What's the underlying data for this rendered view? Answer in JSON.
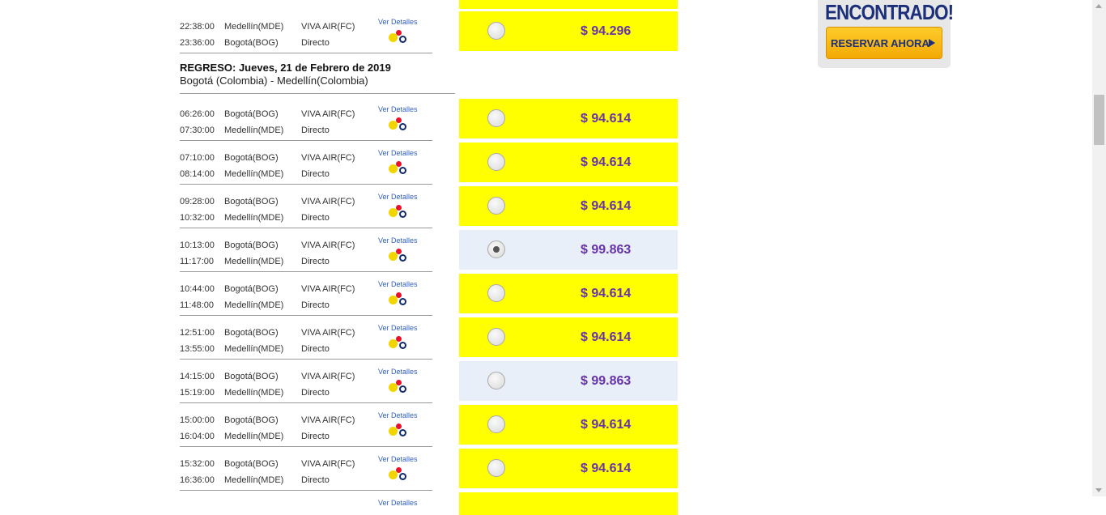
{
  "colors": {
    "price_bg": "#ffff00",
    "selected_bg": "#e9eff8",
    "price_text": "#6633aa",
    "link": "#3060c0"
  },
  "outbound": {
    "flights": [
      {
        "dep_time": "22:38:00",
        "dep_city": "Medellín(MDE)",
        "arr_time": "23:36:00",
        "arr_city": "Bogotá(BOG)",
        "airline": "VIVA AIR(FC)",
        "stops": "Directo",
        "details": "Ver Detalles",
        "price": "$ 94.296",
        "selected": false
      }
    ]
  },
  "return_section": {
    "title": "REGRESO: Jueves, 21 de Febrero de 2019",
    "route": "Bogotá (Colombia) - Medellín(Colombia)",
    "flights": [
      {
        "dep_time": "06:26:00",
        "dep_city": "Bogotá(BOG)",
        "arr_time": "07:30:00",
        "arr_city": "Medellín(MDE)",
        "airline": "VIVA AIR(FC)",
        "stops": "Directo",
        "details": "Ver Detalles",
        "price": "$ 94.614",
        "selected": false
      },
      {
        "dep_time": "07:10:00",
        "dep_city": "Bogotá(BOG)",
        "arr_time": "08:14:00",
        "arr_city": "Medellín(MDE)",
        "airline": "VIVA AIR(FC)",
        "stops": "Directo",
        "details": "Ver Detalles",
        "price": "$ 94.614",
        "selected": false
      },
      {
        "dep_time": "09:28:00",
        "dep_city": "Bogotá(BOG)",
        "arr_time": "10:32:00",
        "arr_city": "Medellín(MDE)",
        "airline": "VIVA AIR(FC)",
        "stops": "Directo",
        "details": "Ver Detalles",
        "price": "$ 94.614",
        "selected": false
      },
      {
        "dep_time": "10:13:00",
        "dep_city": "Bogotá(BOG)",
        "arr_time": "11:17:00",
        "arr_city": "Medellín(MDE)",
        "airline": "VIVA AIR(FC)",
        "stops": "Directo",
        "details": "Ver Detalles",
        "price": "$ 99.863",
        "selected": true,
        "highlight": "plain"
      },
      {
        "dep_time": "10:44:00",
        "dep_city": "Bogotá(BOG)",
        "arr_time": "11:48:00",
        "arr_city": "Medellín(MDE)",
        "airline": "VIVA AIR(FC)",
        "stops": "Directo",
        "details": "Ver Detalles",
        "price": "$ 94.614",
        "selected": false
      },
      {
        "dep_time": "12:51:00",
        "dep_city": "Bogotá(BOG)",
        "arr_time": "13:55:00",
        "arr_city": "Medellín(MDE)",
        "airline": "VIVA AIR(FC)",
        "stops": "Directo",
        "details": "Ver Detalles",
        "price": "$ 94.614",
        "selected": false
      },
      {
        "dep_time": "14:15:00",
        "dep_city": "Bogotá(BOG)",
        "arr_time": "15:19:00",
        "arr_city": "Medellín(MDE)",
        "airline": "VIVA AIR(FC)",
        "stops": "Directo",
        "details": "Ver Detalles",
        "price": "$ 99.863",
        "selected": false,
        "highlight": "plain"
      },
      {
        "dep_time": "15:00:00",
        "dep_city": "Bogotá(BOG)",
        "arr_time": "16:04:00",
        "arr_city": "Medellín(MDE)",
        "airline": "VIVA AIR(FC)",
        "stops": "Directo",
        "details": "Ver Detalles",
        "price": "$ 94.614",
        "selected": false
      },
      {
        "dep_time": "15:32:00",
        "dep_city": "Bogotá(BOG)",
        "arr_time": "16:36:00",
        "arr_city": "Medellín(MDE)",
        "airline": "VIVA AIR(FC)",
        "stops": "Directo",
        "details": "Ver Detalles",
        "price": "$ 94.614",
        "selected": false
      },
      {
        "dep_time": "",
        "dep_city": "",
        "arr_time": "",
        "arr_city": "",
        "airline": "",
        "stops": "",
        "details": "Ver Detalles",
        "price": "",
        "selected": false,
        "partial": true
      }
    ]
  },
  "promo": {
    "headline": "ENCONTRADO!",
    "button_label": "RESERVAR AHORA"
  }
}
